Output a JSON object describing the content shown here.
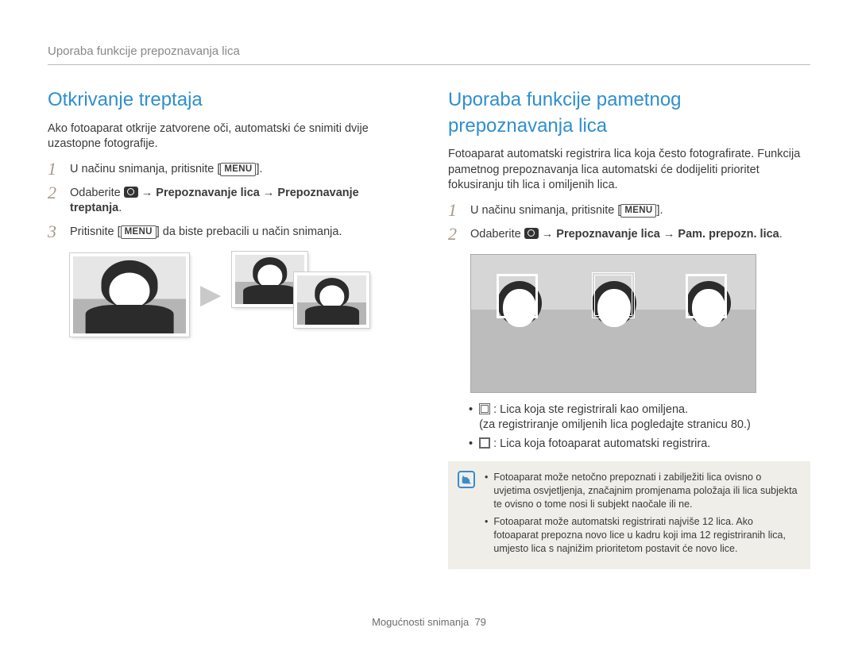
{
  "header": "Uporaba funkcije prepoznavanja lica",
  "left": {
    "title": "Otkrivanje treptaja",
    "intro": "Ako fotoaparat otkrije zatvorene oči, automatski će snimiti dvije uzastopne fotografije.",
    "step1_pre": "U načinu snimanja, pritisnite [",
    "step1_menu": "MENU",
    "step1_post": "].",
    "step2_pre": "Odaberite ",
    "step2_arrow1": " → ",
    "step2_b1": "Prepoznavanje lica",
    "step2_arrow2": " → ",
    "step2_b2": "Prepoznavanje treptanja",
    "step2_post": ".",
    "step3_pre": "Pritisnite [",
    "step3_menu": "MENU",
    "step3_post": "] da biste prebacili u način snimanja."
  },
  "right": {
    "title": "Uporaba funkcije pametnog prepoznavanja lica",
    "intro": "Fotoaparat automatski registrira lica koja često fotografirate. Funkcija pametnog prepoznavanja lica automatski će dodijeliti prioritet fokusiranju tih lica i omiljenih lica.",
    "step1_pre": "U načinu snimanja, pritisnite [",
    "step1_menu": "MENU",
    "step1_post": "].",
    "step2_pre": "Odaberite ",
    "step2_arrow1": " → ",
    "step2_b1": "Prepoznavanje lica",
    "step2_arrow2": " → ",
    "step2_b2": "Pam. prepozn. lica",
    "step2_post": ".",
    "list1a": ": Lica koja ste registrirali kao omiljena.",
    "list1b": "(za registriranje omiljenih lica pogledajte stranicu 80.)",
    "list2": ": Lica koja fotoaparat automatski registrira.",
    "note1": "Fotoaparat može netočno prepoznati i zabilježiti lica ovisno o uvjetima osvjetljenja, značajnim promjenama položaja ili lica subjekta te ovisno o tome nosi li subjekt naočale ili ne.",
    "note2": "Fotoaparat može automatski registrirati najviše 12 lica. Ako fotoaparat prepozna novo lice u kadru koji ima 12 registriranih lica, umjesto lica s najnižim prioritetom postavit će novo lice."
  },
  "footer": {
    "category": "Mogućnosti snimanja",
    "page": "79"
  }
}
